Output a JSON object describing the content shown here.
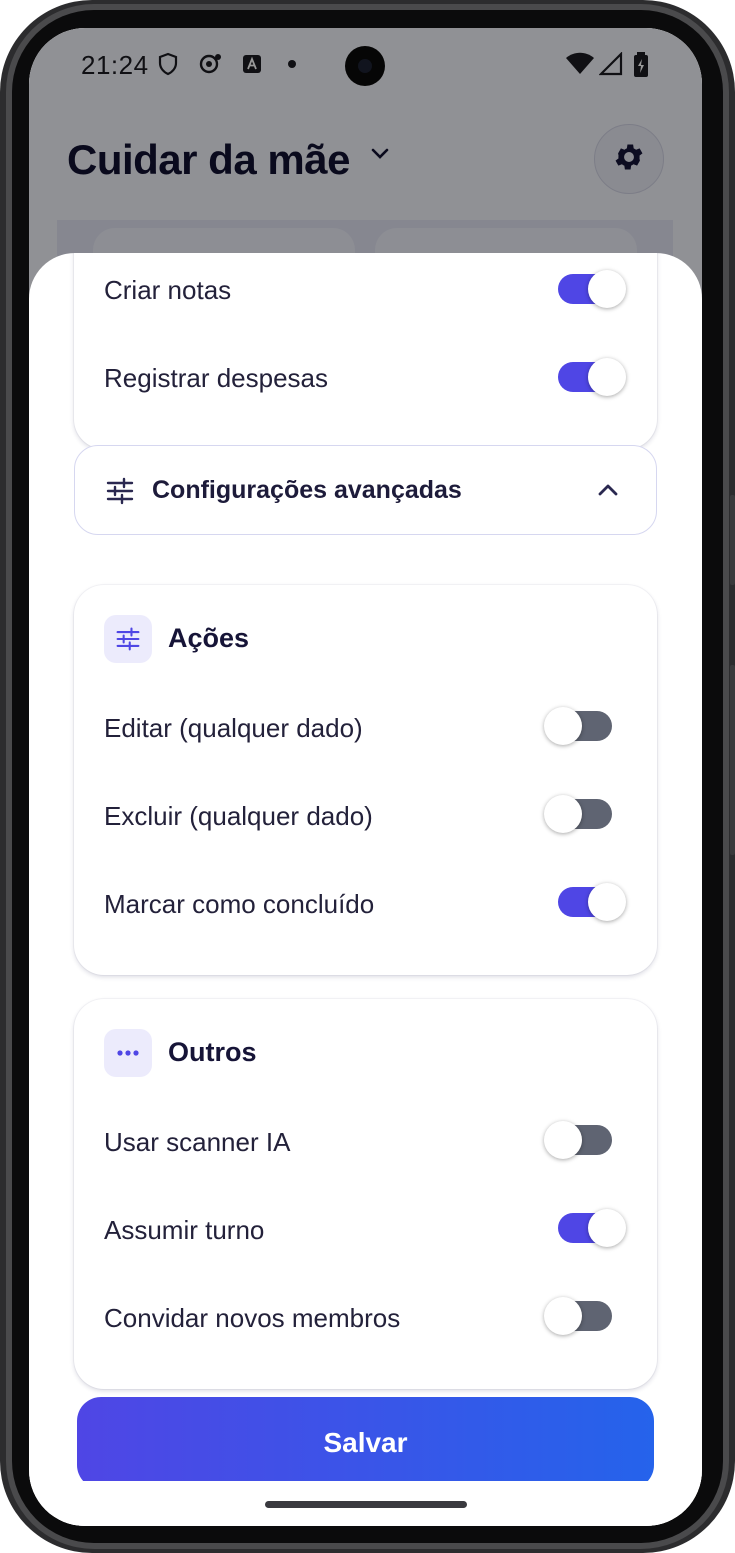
{
  "status_bar": {
    "time": "21:24"
  },
  "app": {
    "title": "Cuidar da mãe",
    "settings_icon": "gear-icon"
  },
  "sheet": {
    "permissions_top": [
      {
        "label": "Criar notas",
        "enabled": true
      },
      {
        "label": "Registrar despesas",
        "enabled": true
      }
    ],
    "advanced": {
      "label": "Configurações avançadas",
      "icon": "sliders-icon",
      "expanded": true
    },
    "acoes": {
      "title": "Ações",
      "icon": "sliders-icon",
      "items": [
        {
          "label": "Editar (qualquer dado)",
          "enabled": false
        },
        {
          "label": "Excluir (qualquer dado)",
          "enabled": false
        },
        {
          "label": "Marcar como concluído",
          "enabled": true
        }
      ]
    },
    "outros": {
      "title": "Outros",
      "icon": "more-dots-icon",
      "items": [
        {
          "label": "Usar scanner IA",
          "enabled": false
        },
        {
          "label": "Assumir turno",
          "enabled": true
        },
        {
          "label": "Convidar novos membros",
          "enabled": false
        }
      ]
    },
    "save_label": "Salvar"
  },
  "colors": {
    "accent": "#4f46e5",
    "accent_end": "#2563eb",
    "toggle_off": "#5f6472",
    "text_primary": "#23213a"
  }
}
